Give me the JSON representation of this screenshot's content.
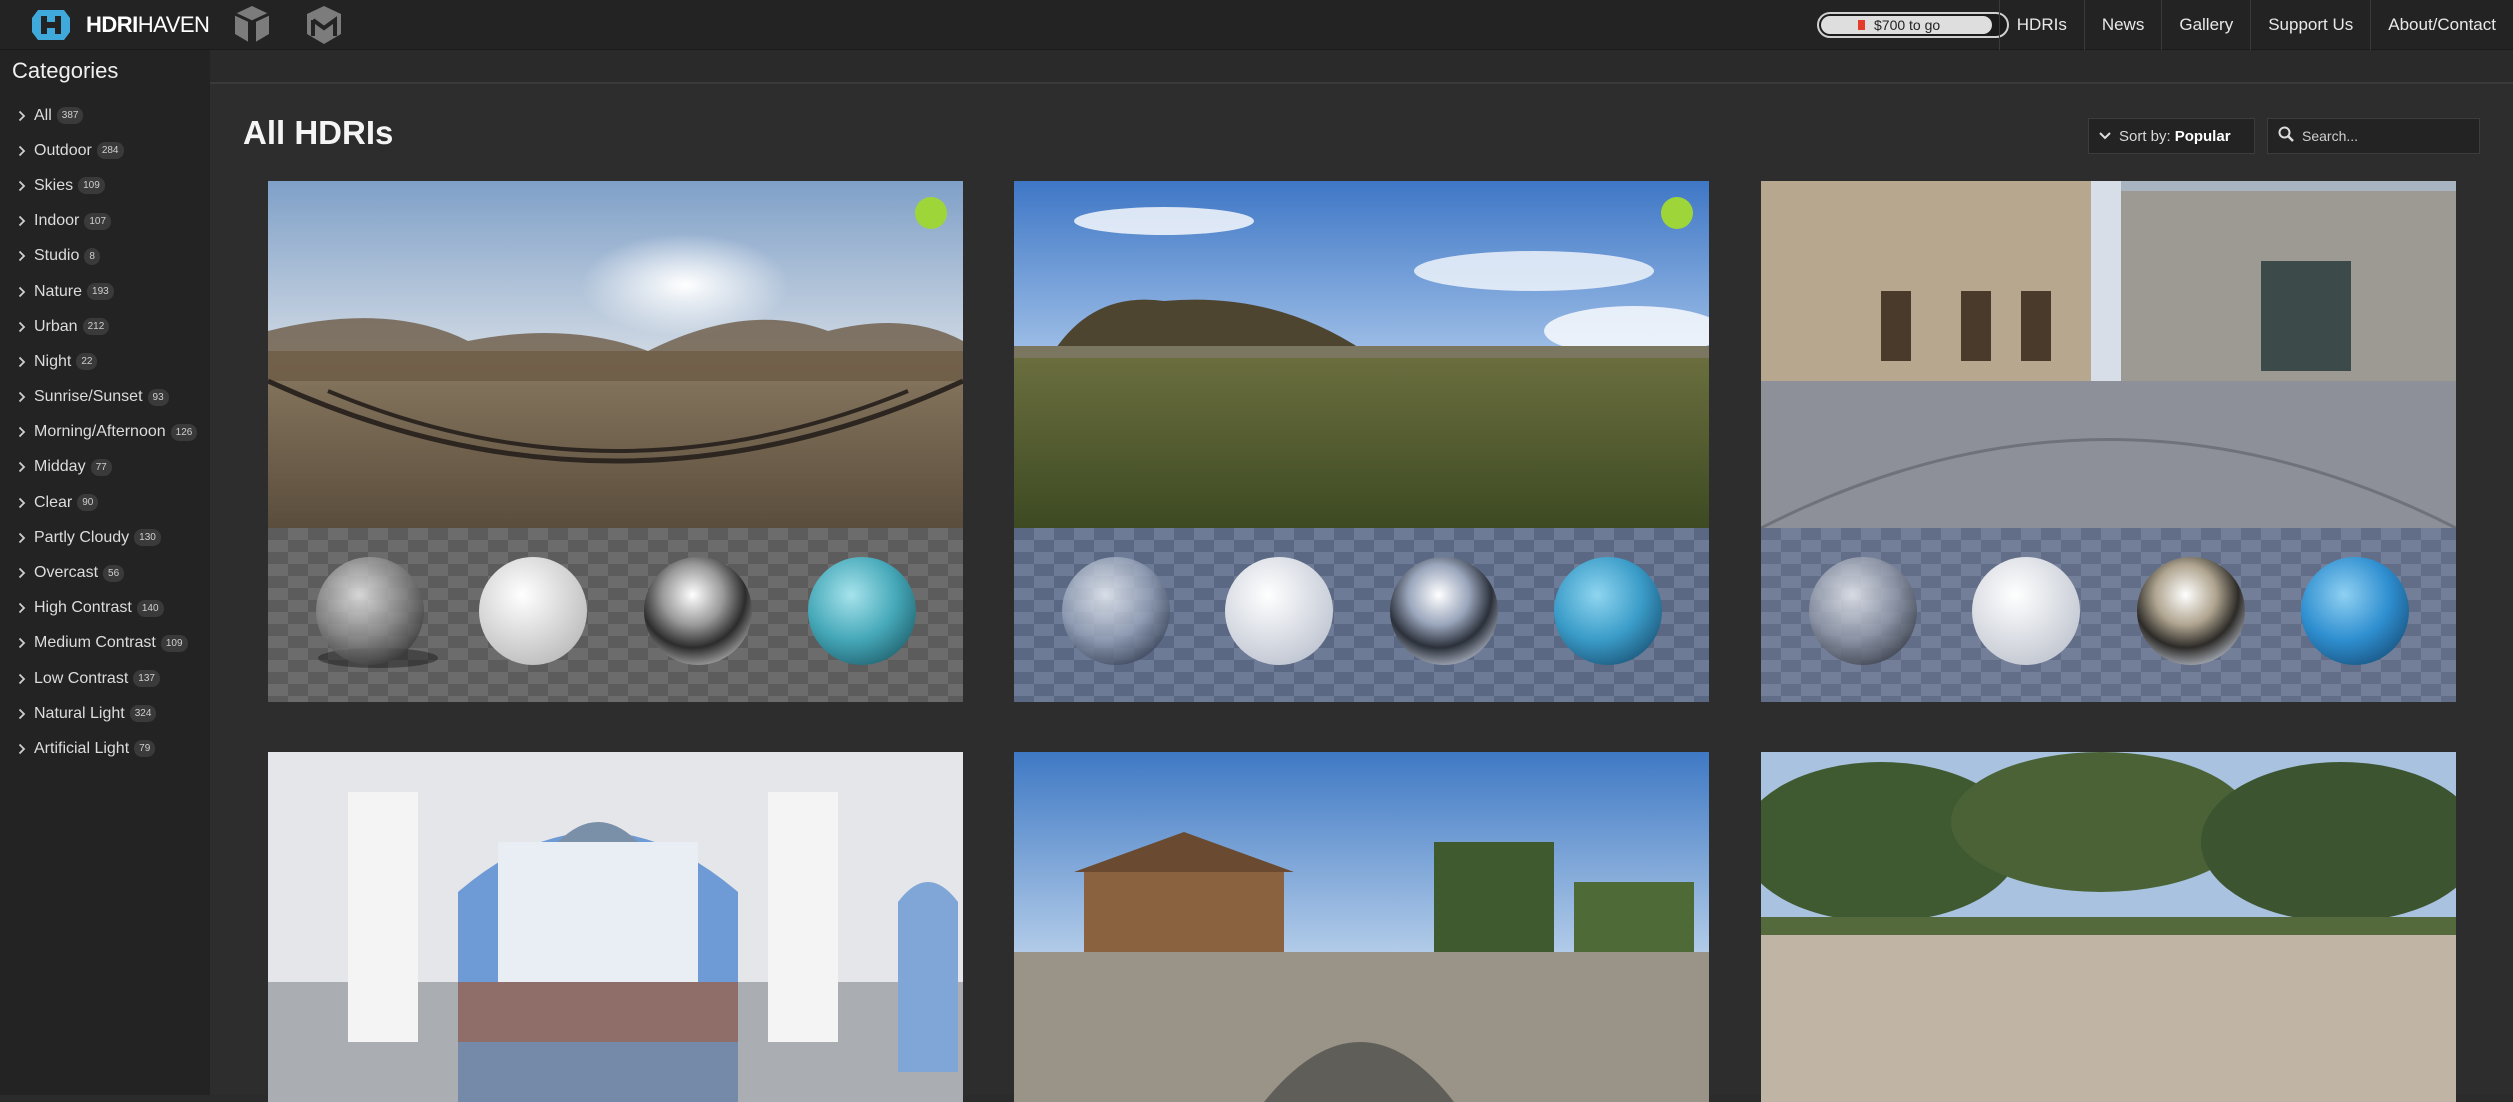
{
  "header": {
    "logo_bold": "HDRI",
    "logo_thin": "HAVEN",
    "funding_text": "$700 to go",
    "funding_progress": 0.91,
    "nav": [
      "HDRIs",
      "News",
      "Gallery",
      "Support Us",
      "About/Contact"
    ]
  },
  "sidebar": {
    "title": "Categories",
    "categories": [
      {
        "label": "All",
        "count": "387"
      },
      {
        "label": "Outdoor",
        "count": "284"
      },
      {
        "label": "Skies",
        "count": "109"
      },
      {
        "label": "Indoor",
        "count": "107"
      },
      {
        "label": "Studio",
        "count": "8"
      },
      {
        "label": "Nature",
        "count": "193"
      },
      {
        "label": "Urban",
        "count": "212"
      },
      {
        "label": "Night",
        "count": "22"
      },
      {
        "label": "Sunrise/Sunset",
        "count": "93"
      },
      {
        "label": "Morning/Afternoon",
        "count": "126"
      },
      {
        "label": "Midday",
        "count": "77"
      },
      {
        "label": "Clear",
        "count": "90"
      },
      {
        "label": "Partly Cloudy",
        "count": "130"
      },
      {
        "label": "Overcast",
        "count": "56"
      },
      {
        "label": "High Contrast",
        "count": "140"
      },
      {
        "label": "Medium Contrast",
        "count": "109"
      },
      {
        "label": "Low Contrast",
        "count": "137"
      },
      {
        "label": "Natural Light",
        "count": "324"
      },
      {
        "label": "Artificial Light",
        "count": "79"
      }
    ]
  },
  "main": {
    "title": "All HDRIs",
    "sort_prefix": "Sort by:",
    "sort_value": "Popular",
    "search_placeholder": "Search..."
  },
  "colors": {
    "accent_new_badge": "#9ed63a",
    "funding_marker": "#e53b2b"
  },
  "icons": [
    "hdrihaven-logo-icon",
    "texturehaven-icon",
    "3dmodelhaven-icon",
    "chevron-right-icon",
    "chevron-down-icon",
    "search-icon"
  ]
}
